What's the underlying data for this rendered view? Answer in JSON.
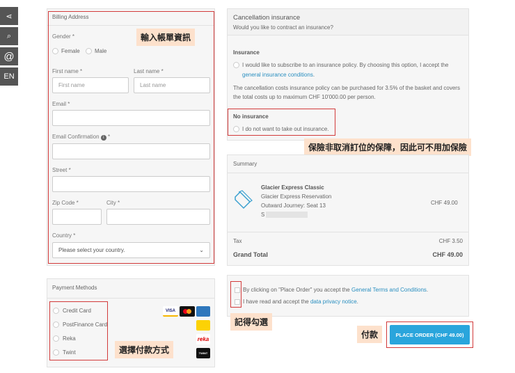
{
  "sidebar": {
    "share": "share-icon",
    "search": "search-icon",
    "at": "@",
    "lang": "EN"
  },
  "billing": {
    "title": "Billing Address",
    "gender": "Gender *",
    "female": "Female",
    "male": "Male",
    "first_name": "First name *",
    "first_ph": "First name",
    "last_name": "Last name *",
    "last_ph": "Last name",
    "email": "Email *",
    "email_conf": "Email Confirmation",
    "email_conf_req": "*",
    "street": "Street *",
    "zip": "Zip Code *",
    "city": "City *",
    "country": "Country *",
    "country_ph": "Please select your country."
  },
  "payment": {
    "title": "Payment Methods",
    "methods": [
      "Credit Card",
      "PostFinance Card",
      "Reka",
      "Twint"
    ],
    "cards": {
      "visa": "VISA",
      "reka": "reka",
      "twint": "TWINT"
    }
  },
  "insurance": {
    "title": "Cancellation insurance",
    "question": "Would you like to contract an insurance?",
    "ins_label": "Insurance",
    "ins_option": "I would like to subscribe to an insurance policy. By choosing this option, I accept the",
    "ins_link": "general insurance conditions",
    "ins_desc": "The cancellation costs insurance policy can be purchased for 3.5% of the basket and covers the total costs up to maximum CHF 10'000.00 per person.",
    "no_label": "No insurance",
    "no_option": "I do not want to take out insurance."
  },
  "summary": {
    "title": "Summary",
    "product": "Glacier Express Classic",
    "line1": "Glacier Express Reservation",
    "line2": "Outward Journey: Seat 13",
    "line3": "S",
    "price": "CHF 49.00",
    "tax_label": "Tax",
    "tax": "CHF 3.50",
    "total_label": "Grand Total",
    "total": "CHF 49.00"
  },
  "terms": {
    "t1": "By clicking on \"Place Order\" you accept the",
    "t1_link": "General Terms and Conditions",
    "t2": "I have read and accept the",
    "t2_link": "data privacy notice"
  },
  "order": {
    "button": "PLACE ORDER (CHF 49.00)"
  },
  "notes": {
    "billing": "輸入帳單資訊",
    "insurance": "保險非取消訂位的保障，因此可不用加保險",
    "payment": "選擇付款方式",
    "check": "記得勾選",
    "pay": "付款"
  }
}
